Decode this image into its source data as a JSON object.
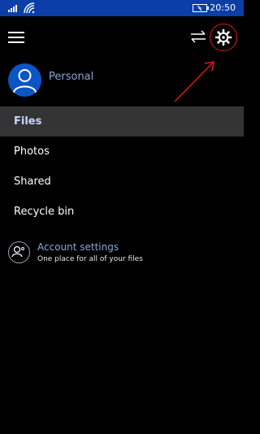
{
  "status_bar": {
    "time": "20:50",
    "icons": [
      "signal-icon",
      "wifi-icon",
      "battery-icon"
    ]
  },
  "header": {
    "icons": [
      "menu-icon",
      "sync-icon",
      "settings-icon"
    ]
  },
  "profile": {
    "name": "Personal"
  },
  "nav": {
    "items": [
      {
        "label": "Files",
        "active": true
      },
      {
        "label": "Photos",
        "active": false
      },
      {
        "label": "Shared",
        "active": false
      },
      {
        "label": "Recycle bin",
        "active": false
      }
    ]
  },
  "account": {
    "title": "Account settings",
    "subtitle": "One place for all of your files"
  },
  "colors": {
    "status_bar": "#0b3ea8",
    "accent": "#8aa6d8",
    "avatar": "#0b55c4",
    "active_row": "#343434",
    "annotation": "#e0151b"
  }
}
